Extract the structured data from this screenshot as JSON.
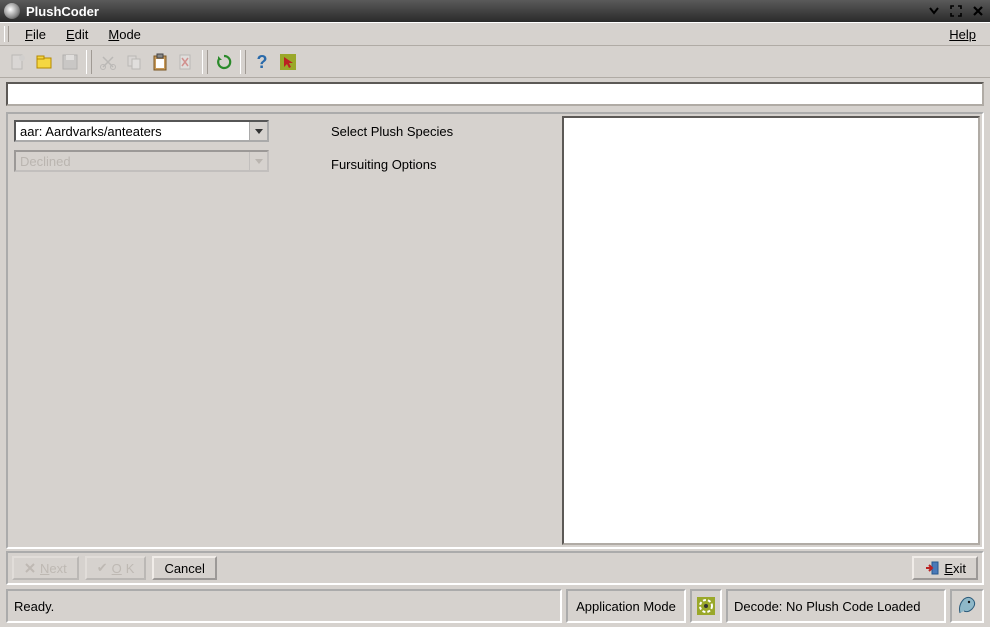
{
  "title": "PlushCoder",
  "menus": {
    "file": "File",
    "edit": "Edit",
    "mode": "Mode",
    "help": "Help"
  },
  "toolbar_icons": {
    "new": "new-document-icon",
    "open": "open-folder-icon",
    "save": "save-icon",
    "cut": "cut-icon",
    "copy": "copy-icon",
    "paste": "paste-icon",
    "delete": "delete-icon",
    "refresh": "refresh-icon",
    "help": "help-icon",
    "cursor": "cursor-icon"
  },
  "main": {
    "species_select": "aar: Aardvarks/anteaters",
    "fursuit_select": "Declined",
    "label_species": "Select Plush Species",
    "label_fursuit": "Fursuiting Options"
  },
  "buttons": {
    "next": "Next",
    "ok": "OK",
    "cancel": "Cancel",
    "exit": "Exit"
  },
  "status": {
    "ready": "Ready.",
    "mode_label": "Application Mode",
    "decode": "Decode: No Plush Code Loaded"
  }
}
